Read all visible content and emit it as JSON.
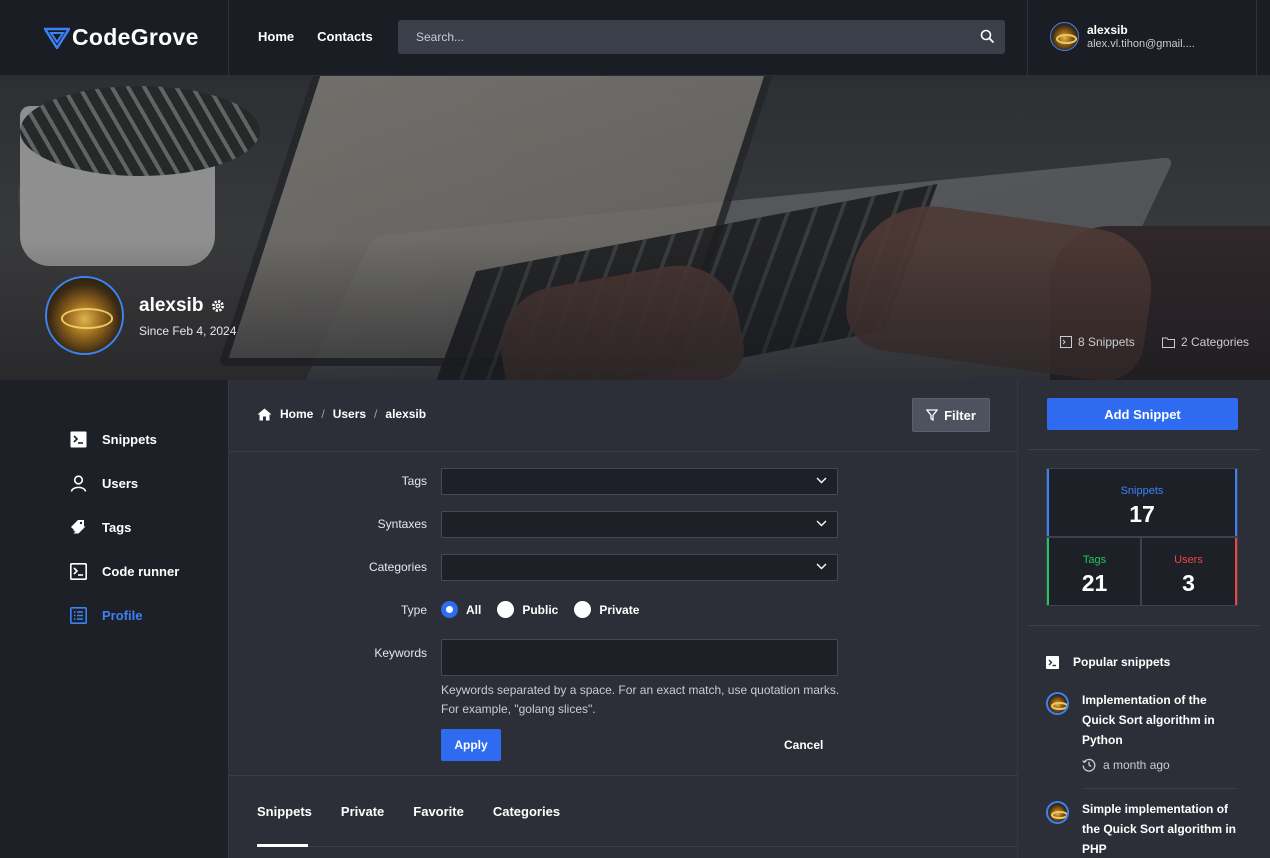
{
  "header": {
    "brand": "CodeGrove",
    "nav": [
      "Home",
      "Contacts"
    ],
    "search_placeholder": "Search...",
    "user_name": "alexsib",
    "user_email": "alex.vl.tihon@gmail...."
  },
  "banner": {
    "name": "alexsib",
    "since": "Since Feb 4, 2024",
    "snippets_count": "8 Snippets",
    "categories_count": "2 Categories"
  },
  "sidebar": {
    "items": [
      {
        "label": "Snippets",
        "icon": "terminal-icon"
      },
      {
        "label": "Users",
        "icon": "user-icon"
      },
      {
        "label": "Tags",
        "icon": "tags-icon"
      },
      {
        "label": "Code runner",
        "icon": "terminal-box-icon"
      },
      {
        "label": "Profile",
        "icon": "list-icon",
        "active": true
      }
    ]
  },
  "breadcrumb": [
    "Home",
    "Users",
    "alexsib"
  ],
  "filter": {
    "button": "Filter",
    "tags_label": "Tags",
    "syntaxes_label": "Syntaxes",
    "categories_label": "Categories",
    "type_label": "Type",
    "type_options": [
      "All",
      "Public",
      "Private"
    ],
    "type_selected": "All",
    "keywords_label": "Keywords",
    "keywords_value": "",
    "hint_line1": "Keywords separated by a space. For an exact match, use quotation marks.",
    "hint_line2": "For example, \"golang slices\".",
    "apply": "Apply",
    "cancel": "Cancel"
  },
  "tabs": [
    "Snippets",
    "Private",
    "Favorite",
    "Categories"
  ],
  "right": {
    "add_snippet": "Add Snippet",
    "stats": {
      "snippets_label": "Snippets",
      "snippets_value": "17",
      "tags_label": "Tags",
      "tags_value": "21",
      "users_label": "Users",
      "users_value": "3"
    },
    "popular_title": "Popular snippets",
    "popular": [
      {
        "title": "Implementation of the Quick Sort algorithm in Python",
        "time": "a month ago"
      },
      {
        "title": "Simple implementation of the Quick Sort algorithm in PHP"
      }
    ]
  },
  "colors": {
    "accent": "#2f6bf1",
    "snippets_stat": "#3b82f6",
    "tags_stat": "#22c55e",
    "users_stat": "#ef4444"
  }
}
